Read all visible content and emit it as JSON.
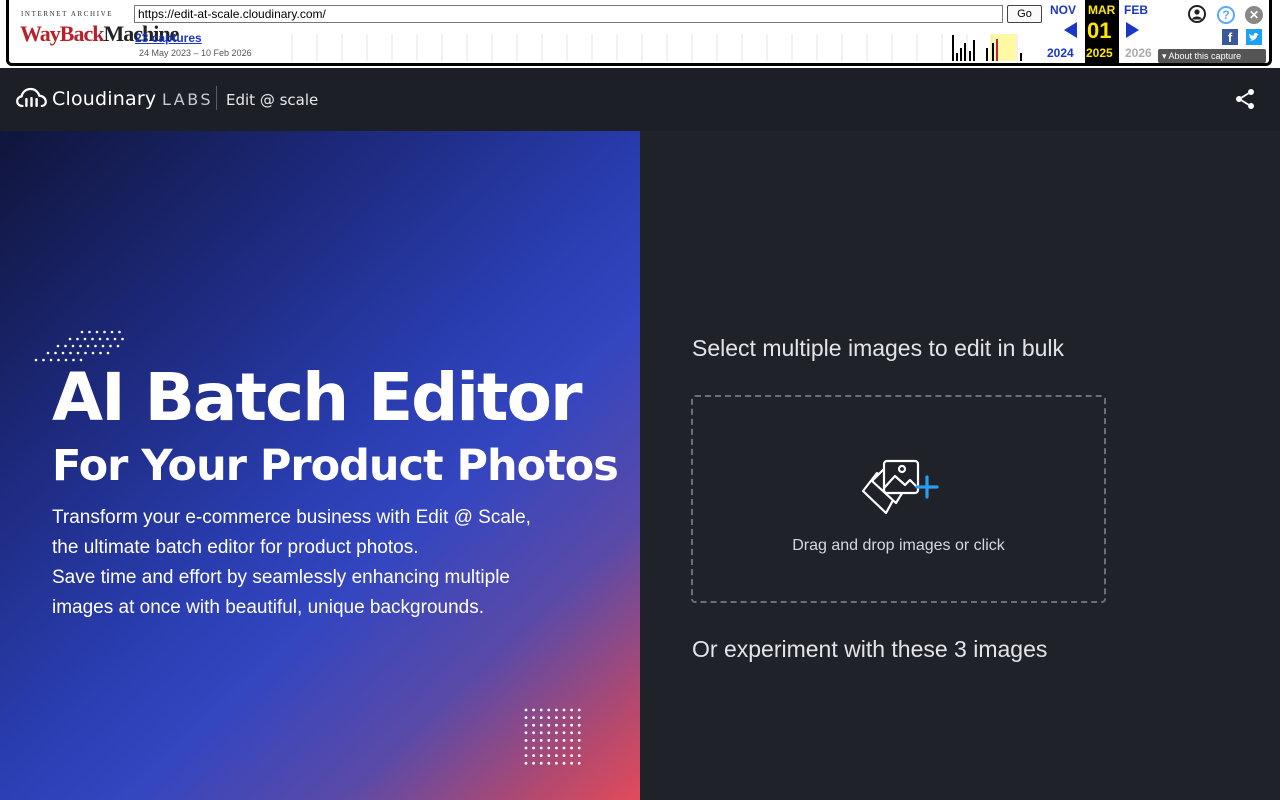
{
  "wayback": {
    "logo_top": "INTERNET ARCHIVE",
    "logo_wayback": "WayBack",
    "logo_machine": "Machine",
    "url": "https://edit-at-scale.cloudinary.com/",
    "go_label": "Go",
    "captures": "23 captures",
    "date_range": "24 May 2023 – 10 Feb 2026",
    "prev_month": "NOV",
    "current_month": "MAR",
    "next_month": "FEB",
    "current_day": "01",
    "prev_year": "2024",
    "current_year": "2025",
    "next_year": "2026",
    "about": "About this capture",
    "help_glyph": "?",
    "close_glyph": "✕",
    "facebook_glyph": "f"
  },
  "header": {
    "brand": "Cloudinary",
    "labs": "LABS",
    "product": "Edit @ scale",
    "share_icon": "share-icon"
  },
  "hero": {
    "title": "AI Batch Editor",
    "subtitle": "For Your Product Photos",
    "body_line1": "Transform your e-commerce business with Edit @ Scale,",
    "body_line2": "the ultimate batch editor for product photos.",
    "body_line3": "Save time and effort by seamlessly enhancing multiple",
    "body_line4": "images at once with beautiful, unique backgrounds."
  },
  "panel": {
    "select_heading": "Select multiple images to edit in bulk",
    "dropzone_text": "Drag and drop images or click",
    "dropzone_icon": "add-images-icon",
    "experiment_heading": "Or experiment with these 3 images"
  },
  "colors": {
    "header_bg": "#1c1f26",
    "panel_bg": "#1f2229",
    "accent_blue": "#2c9cf0",
    "wayback_blue": "#1a38c4",
    "wayback_yellow": "#ffe800"
  }
}
